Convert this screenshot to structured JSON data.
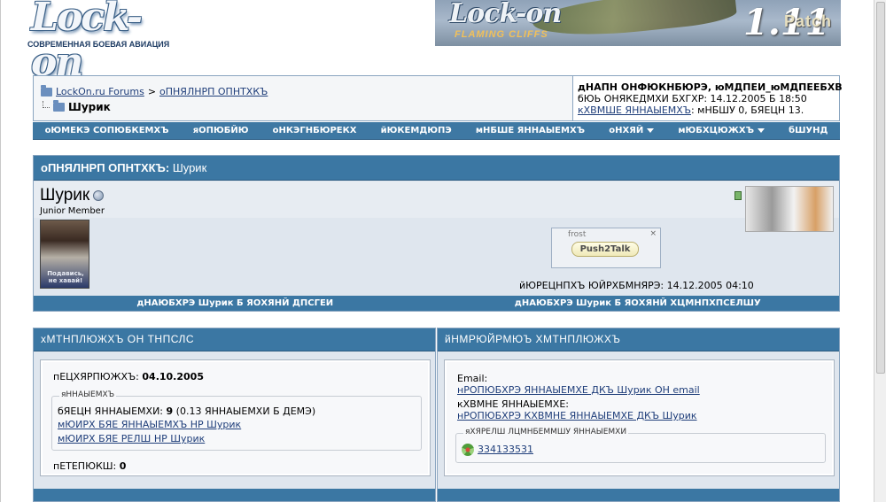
{
  "header": {
    "logo_text": "Lock-on",
    "logo_subtitle": "СОВРЕМЕННАЯ БОЕВАЯ АВИАЦИЯ",
    "banner": {
      "title": "Lock-on",
      "subtitle": "FLAMING CLIFFS",
      "version": "1.11",
      "patch": "Patch"
    }
  },
  "breadcrumb": {
    "forum_link": "LockOn.ru Forums",
    "separator": ">",
    "section_link": "оПНЯЛНРП ОПНТХКЪ",
    "current": "Шурик"
  },
  "welcome": {
    "greeting": "дНАПН ОНФЮКНБЮРЭ, юМДПЕИ_юМДПЕЕБХВ",
    "last_visit": "бЮЬ ОНЯКЕДМХИ БХГХР: 14.12.2005 Б 18:50",
    "private_messages_link": "кХВМШЕ ЯННАЫЕМХЪ",
    "private_messages_info": ": мНБШУ 0, БЯЕЦН 13."
  },
  "menubar": [
    {
      "label": "оЮМЕКЭ СОПЮБКЕМХЪ",
      "dropdown": false
    },
    {
      "label": "яОПЮБЙЮ",
      "dropdown": false
    },
    {
      "label": "оНКЭГНБЮРЕКХ",
      "dropdown": false
    },
    {
      "label": "йЮКЕМДЮПЭ",
      "dropdown": false
    },
    {
      "label": "мНБШЕ ЯННАЫЕМХЪ",
      "dropdown": false
    },
    {
      "label": "оНХЯЙ",
      "dropdown": true
    },
    {
      "label": "мЮБХЦЮЖХЪ",
      "dropdown": true
    },
    {
      "label": "бШУНД",
      "dropdown": false
    }
  ],
  "profile": {
    "header_prefix": "оПНЯЛНРП ОПНТХКЪ:",
    "header_name": "Шурик",
    "username": "Шурик",
    "user_title": "Junior Member",
    "avatar_caption": "Подавись, не хавай!",
    "push2talk": {
      "name": "frost",
      "button": "Push2Talk",
      "close": "×"
    },
    "last_activity": "йЮРЕЦНПХЪ ЮЙРХБМНЯРЭ: 14.12.2005 04:10",
    "add_buddy": "дНАЮБХРЭ Шурик Б ЯОХЯНЙ ДПСГЕИ",
    "add_ignore": "дНАЮБХРЭ Шурик Б ЯОХЯНЙ ХЦМНПХПСЕЛШУ"
  },
  "forum_info": {
    "title": "хМТНПЛЮЖХЪ ОН ТНПСЛС",
    "join_label": "пЕЦХЯРПЮЖХЪ:",
    "join_value": "04.10.2005",
    "posts_legend": "яННАЫЕМХЪ",
    "posts_label": "бЯЕЦН ЯННАЫЕМХИ:",
    "posts_value": "9",
    "posts_per_day": "(0.13 ЯННАЫЕМХИ Б ДЕМЭ)",
    "find_posts_link": "мЮИРХ БЯЕ ЯННАЫЕМХЪ НР Шурик",
    "find_threads_link": "мЮИРХ БЯЕ РЕЛШ НР Шурик",
    "referrals_label": "пЕТЕПЮКШ:",
    "referrals_value": "0"
  },
  "contact_info": {
    "title": "йНМРЮЙРМЮЪ ХМТНПЛЮЖХЪ",
    "email_label": "Email:",
    "email_link": "нРОПЮБХРЭ ЯННАЫЕМХЕ ДКЪ Шурик ОН email",
    "pm_label": "кХВМНЕ ЯННАЫЕМХЕ:",
    "pm_link": "нРОПЮБХРЭ КХВМНЕ ЯННАЫЕМХЕ ДКЪ Шурик",
    "im_legend": "яХЯРЕЛШ ЛЦМНБЕММШУ ЯННАЫЕМХИ",
    "icq_number": "334133531"
  },
  "colors": {
    "header_blue": "#3b77a3",
    "panel_bg": "#dfe6ee",
    "link": "#1f3e7a"
  }
}
